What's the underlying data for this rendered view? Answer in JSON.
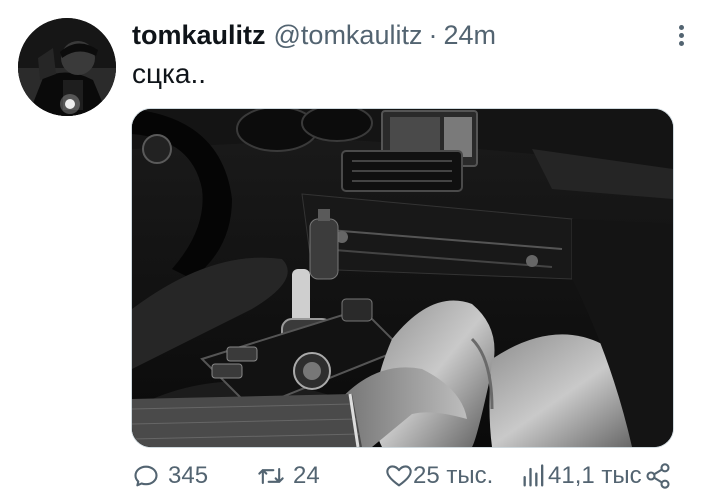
{
  "tweet": {
    "display_name": "tomkaulitz",
    "handle": "@tomkaulitz",
    "separator": "·",
    "time": "24m",
    "text": "сцка..",
    "media_description": "black-and-white photo of a car interior"
  },
  "actions": {
    "reply_count": "345",
    "retweet_count": "24",
    "like_count": "25 тыс.",
    "views_count": "41,1 тыс"
  },
  "colors": {
    "text": "#0f1419",
    "muted": "#536471",
    "border": "#cfd9de"
  }
}
